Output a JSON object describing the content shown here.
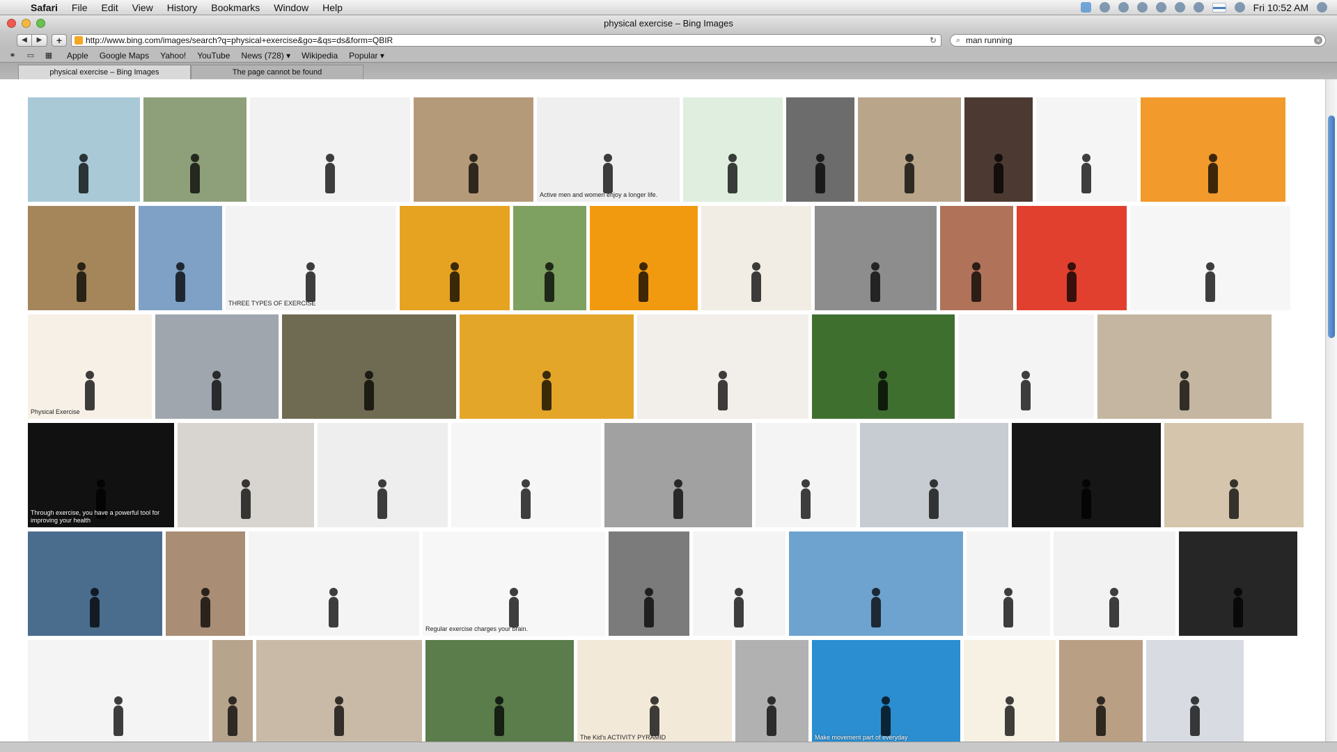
{
  "menubar": {
    "apple": "",
    "items": [
      "Safari",
      "File",
      "Edit",
      "View",
      "History",
      "Bookmarks",
      "Window",
      "Help"
    ],
    "clock": "Fri 10:52 AM"
  },
  "window": {
    "title": "physical exercise – Bing Images"
  },
  "toolbar": {
    "back": "◀",
    "forward": "▶",
    "add": "+",
    "url": "http://www.bing.com/images/search?q=physical+exercise&go=&qs=ds&form=QBIR",
    "reload": "↻",
    "search_value": "man running",
    "search_glyph": "⌕",
    "clear": "×"
  },
  "bookmarks": {
    "items": [
      "Apple",
      "Google Maps",
      "Yahoo!",
      "YouTube",
      "News (728) ▾",
      "Wikipedia",
      "Popular ▾"
    ]
  },
  "tabs": [
    {
      "label": "physical exercise – Bing Images"
    },
    {
      "label": "The page cannot be found"
    }
  ],
  "results": {
    "rows": [
      {
        "thumbs": [
          {
            "w": 161,
            "bg": "#a9c9d6",
            "cap": ""
          },
          {
            "w": 148,
            "bg": "#8ea07a",
            "cap": ""
          },
          {
            "w": 230,
            "bg": "#f2f2f2",
            "cap": ""
          },
          {
            "w": 172,
            "bg": "#b59a7a",
            "cap": ""
          },
          {
            "w": 205,
            "bg": "#efefef",
            "cap": "Active men and women enjoy a longer life."
          },
          {
            "w": 143,
            "bg": "#dfeede",
            "cap": ""
          },
          {
            "w": 98,
            "bg": "#6c6c6c",
            "cap": ""
          },
          {
            "w": 148,
            "bg": "#b8a58a",
            "cap": ""
          },
          {
            "w": 98,
            "bg": "#4c3a32",
            "cap": ""
          },
          {
            "w": 145,
            "bg": "#f5f5f5",
            "cap": ""
          },
          {
            "w": 208,
            "bg": "#f29a2c",
            "cap": ""
          }
        ]
      },
      {
        "thumbs": [
          {
            "w": 154,
            "bg": "#a4865a",
            "cap": ""
          },
          {
            "w": 120,
            "bg": "#7ea1c5",
            "cap": ""
          },
          {
            "w": 245,
            "bg": "#f3f3f3",
            "cap": "THREE TYPES OF EXERCISE"
          },
          {
            "w": 158,
            "bg": "#e6a322",
            "cap": ""
          },
          {
            "w": 105,
            "bg": "#7ea060",
            "cap": ""
          },
          {
            "w": 155,
            "bg": "#f19a10",
            "cap": ""
          },
          {
            "w": 158,
            "bg": "#f1ece4",
            "cap": ""
          },
          {
            "w": 175,
            "bg": "#8d8d8d",
            "cap": ""
          },
          {
            "w": 105,
            "bg": "#b0735a",
            "cap": ""
          },
          {
            "w": 158,
            "bg": "#e2402f",
            "cap": ""
          },
          {
            "w": 230,
            "bg": "#f6f6f6",
            "cap": ""
          }
        ]
      },
      {
        "thumbs": [
          {
            "w": 178,
            "bg": "#f7f0e6",
            "cap": "Physical Exercise"
          },
          {
            "w": 177,
            "bg": "#9fa6ad",
            "cap": ""
          },
          {
            "w": 250,
            "bg": "#6f6b52",
            "cap": ""
          },
          {
            "w": 250,
            "bg": "#e4a628",
            "cap": ""
          },
          {
            "w": 246,
            "bg": "#f2eeea",
            "cap": ""
          },
          {
            "w": 205,
            "bg": "#3f6f2f",
            "cap": ""
          },
          {
            "w": 195,
            "bg": "#f4f4f4",
            "cap": ""
          },
          {
            "w": 250,
            "bg": "#c4b6a0",
            "cap": ""
          }
        ]
      },
      {
        "thumbs": [
          {
            "w": 210,
            "bg": "#111111",
            "cap": "Through exercise, you have a powerful tool for improving your health"
          },
          {
            "w": 196,
            "bg": "#d8d4cf",
            "cap": ""
          },
          {
            "w": 187,
            "bg": "#efeeee",
            "cap": ""
          },
          {
            "w": 215,
            "bg": "#f6f6f6",
            "cap": ""
          },
          {
            "w": 212,
            "bg": "#a1a1a1",
            "cap": ""
          },
          {
            "w": 145,
            "bg": "#f4f4f4",
            "cap": ""
          },
          {
            "w": 213,
            "bg": "#c6ccd1",
            "cap": ""
          },
          {
            "w": 214,
            "bg": "#161616",
            "cap": ""
          },
          {
            "w": 200,
            "bg": "#d4c5ac",
            "cap": ""
          }
        ]
      },
      {
        "thumbs": [
          {
            "w": 193,
            "bg": "#4a6d8e",
            "cap": ""
          },
          {
            "w": 114,
            "bg": "#a98d74",
            "cap": ""
          },
          {
            "w": 245,
            "bg": "#f4f4f4",
            "cap": ""
          },
          {
            "w": 262,
            "bg": "#f7f7f7",
            "cap": "Regular exercise charges your brain."
          },
          {
            "w": 116,
            "bg": "#7b7b7b",
            "cap": ""
          },
          {
            "w": 133,
            "bg": "#f4f4f4",
            "cap": ""
          },
          {
            "w": 250,
            "bg": "#6fa3cf",
            "cap": ""
          },
          {
            "w": 120,
            "bg": "#f4f4f4",
            "cap": ""
          },
          {
            "w": 175,
            "bg": "#f2f2f2",
            "cap": ""
          },
          {
            "w": 170,
            "bg": "#262626",
            "cap": ""
          }
        ]
      },
      {
        "thumbs": [
          {
            "w": 260,
            "bg": "#f4f4f4",
            "cap": ""
          },
          {
            "w": 58,
            "bg": "#b7a48d",
            "cap": ""
          },
          {
            "w": 238,
            "bg": "#c9b9a7",
            "cap": ""
          },
          {
            "w": 213,
            "bg": "#5a7d4b",
            "cap": ""
          },
          {
            "w": 222,
            "bg": "#f3e9d9",
            "cap": "The Kid's ACTIVITY PYRAMID"
          },
          {
            "w": 105,
            "bg": "#b1b1b1",
            "cap": ""
          },
          {
            "w": 213,
            "bg": "#2a8ed1",
            "cap": "Make movement part of everyday"
          },
          {
            "w": 132,
            "bg": "#f6f1e3",
            "cap": ""
          },
          {
            "w": 120,
            "bg": "#b99f84",
            "cap": ""
          },
          {
            "w": 140,
            "bg": "#d8dce2",
            "cap": ""
          }
        ]
      }
    ]
  }
}
